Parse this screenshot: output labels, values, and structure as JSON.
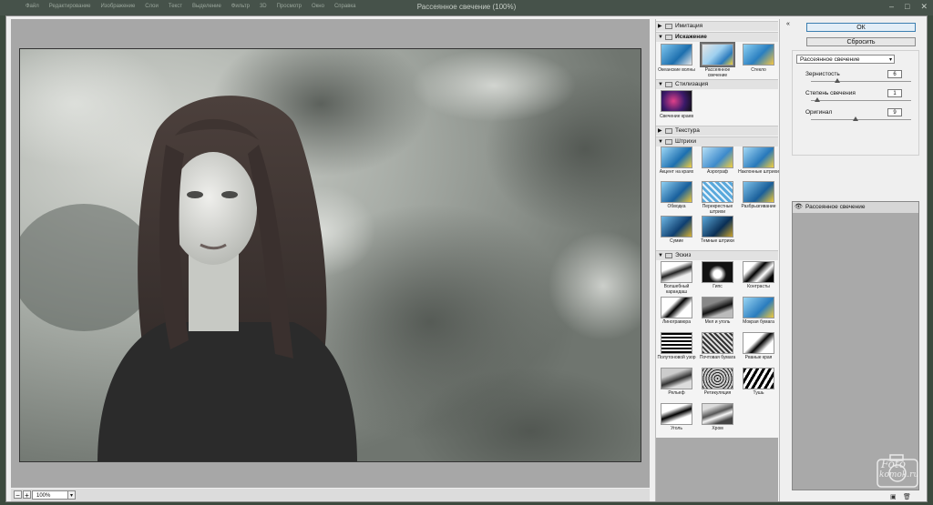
{
  "window": {
    "title": "Рассеянное свечение (100%)",
    "menu": [
      "Файл",
      "Редактирование",
      "Изображение",
      "Слои",
      "Текст",
      "Выделение",
      "Фильтр",
      "3D",
      "Просмотр",
      "Окно",
      "Справка"
    ],
    "controls": {
      "minimize": "–",
      "maximize": "□",
      "close": "✕"
    }
  },
  "preview": {
    "zoom": "100%",
    "minus": "−",
    "plus": "+",
    "zoom_arrow": "▾"
  },
  "gallery": {
    "categories": [
      {
        "label": "Имитация",
        "expanded": false
      },
      {
        "label": "Искажение",
        "expanded": true,
        "items": [
          "Океанские волны",
          "Рассеянное свечение",
          "Стекло"
        ],
        "selected": 1
      },
      {
        "label": "Стилизация",
        "expanded": true,
        "items": [
          "Свечение краев"
        ]
      },
      {
        "label": "Текстура",
        "expanded": false
      },
      {
        "label": "Штрихи",
        "expanded": true,
        "items": [
          "Акцент на краях",
          "Аэрограф",
          "Наклонные штрихи",
          "Обводка",
          "Перекрестные штрихи",
          "Разбрызгивание",
          "Сумие",
          "Темные штрихи"
        ]
      },
      {
        "label": "Эскиз",
        "expanded": true,
        "items": [
          "Волшебный карандаш",
          "Гипс",
          "Контрасты",
          "Линогравюра",
          "Мел и уголь",
          "Мокрая бумага",
          "Полутоновой узор",
          "Почтовая бумага",
          "Рваные края",
          "Рельеф",
          "Ретикуляция",
          "Тушь",
          "Уголь",
          "Хром"
        ]
      }
    ],
    "expand_marker": "▼",
    "collapse_marker": "▶"
  },
  "buttons": {
    "ok": "ОК",
    "reset": "Сбросить",
    "collapse": "«"
  },
  "filter_settings": {
    "selected_filter": "Рассеянное свечение",
    "params": [
      {
        "label": "Зернистость",
        "value": "6",
        "level": 0.6
      },
      {
        "label": "Степень свечения",
        "value": "1",
        "level": 0.05
      },
      {
        "label": "Оригинал",
        "value": "9",
        "level": 0.45
      }
    ]
  },
  "layers": {
    "items": [
      "Рассеянное свечение"
    ],
    "new_icon": "new-layer-icon",
    "delete_icon": "trash-icon"
  },
  "watermark": {
    "line1": "Foto",
    "line2": "komok.ru"
  },
  "colors": {
    "accent": "#3c7fb1",
    "window": "#46524a",
    "panel": "#efefef"
  }
}
